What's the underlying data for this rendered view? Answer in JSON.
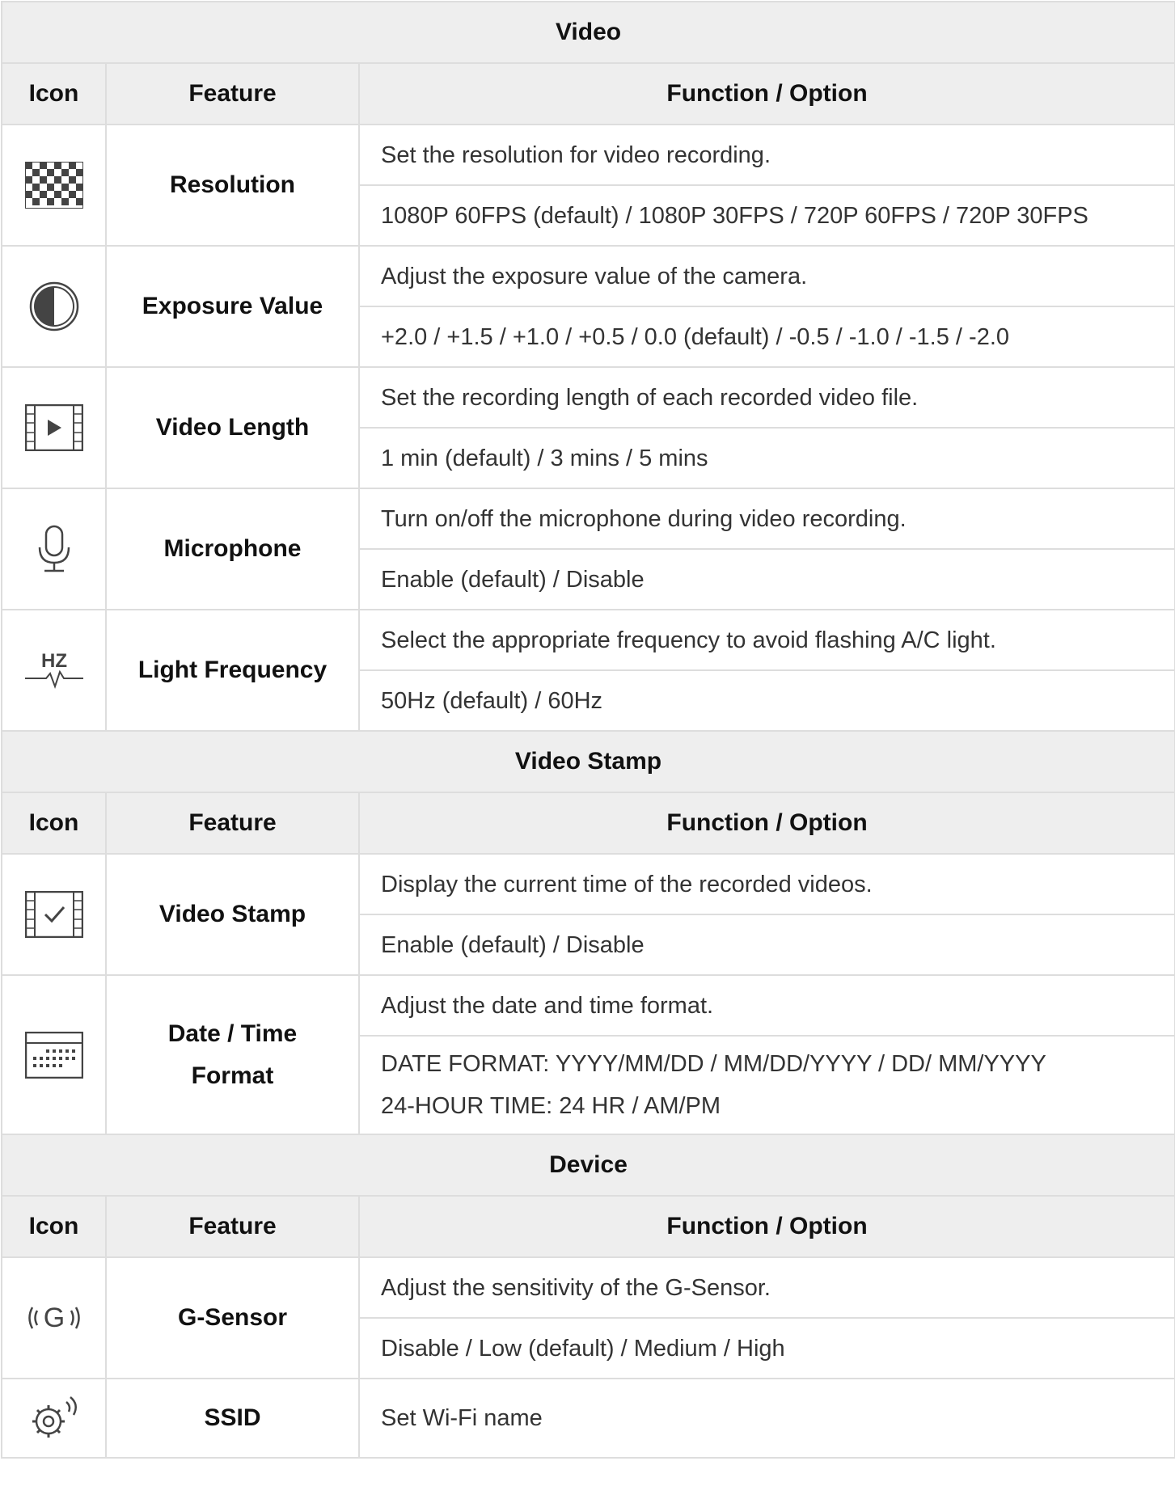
{
  "sections": [
    {
      "title": "Video",
      "headers": {
        "icon": "Icon",
        "feature": "Feature",
        "function": "Function / Option"
      },
      "rows": [
        {
          "icon": "checkerboard-icon",
          "feature": "Resolution",
          "description": "Set the resolution for video recording.",
          "options": "1080P 60FPS (default) / 1080P 30FPS / 720P 60FPS / 720P 30FPS"
        },
        {
          "icon": "exposure-icon",
          "feature": "Exposure Value",
          "description": "Adjust the exposure value of the camera.",
          "options": "+2.0 / +1.5 / +1.0 / +0.5 / 0.0 (default) / -0.5 / -1.0 / -1.5 / -2.0"
        },
        {
          "icon": "video-play-icon",
          "feature": "Video Length",
          "description": "Set the recording length of each recorded video file.",
          "options": "1 min (default) / 3 mins / 5 mins"
        },
        {
          "icon": "microphone-icon",
          "feature": "Microphone",
          "description": "Turn on/off the microphone during video recording.",
          "options": "Enable (default) / Disable"
        },
        {
          "icon": "hz-icon",
          "feature": "Light Frequency",
          "description": "Select the appropriate frequency to avoid flashing A/C light.",
          "options": "50Hz (default) / 60Hz"
        }
      ]
    },
    {
      "title": "Video Stamp",
      "headers": {
        "icon": "Icon",
        "feature": "Feature",
        "function": "Function / Option"
      },
      "rows": [
        {
          "icon": "video-check-icon",
          "feature": "Video Stamp",
          "description": "Display the current time of the recorded videos.",
          "options": "Enable (default) / Disable"
        },
        {
          "icon": "calendar-icon",
          "feature_line1": "Date / Time",
          "feature_line2": "Format",
          "description": "Adjust the date and time format.",
          "options_line1": "DATE FORMAT: YYYY/MM/DD / MM/DD/YYYY / DD/ MM/YYYY",
          "options_line2": "24-HOUR TIME: 24 HR / AM/PM"
        }
      ]
    },
    {
      "title": "Device",
      "headers": {
        "icon": "Icon",
        "feature": "Feature",
        "function": "Function / Option"
      },
      "rows": [
        {
          "icon": "g-sensor-icon",
          "feature": "G-Sensor",
          "description": "Adjust the sensitivity of the G-Sensor.",
          "options": "Disable / Low (default) / Medium / High"
        },
        {
          "icon": "wifi-gear-icon",
          "feature": "SSID",
          "description": "Set Wi-Fi name"
        }
      ]
    }
  ],
  "hz_icon_text": "HZ",
  "g_icon_text": "G"
}
